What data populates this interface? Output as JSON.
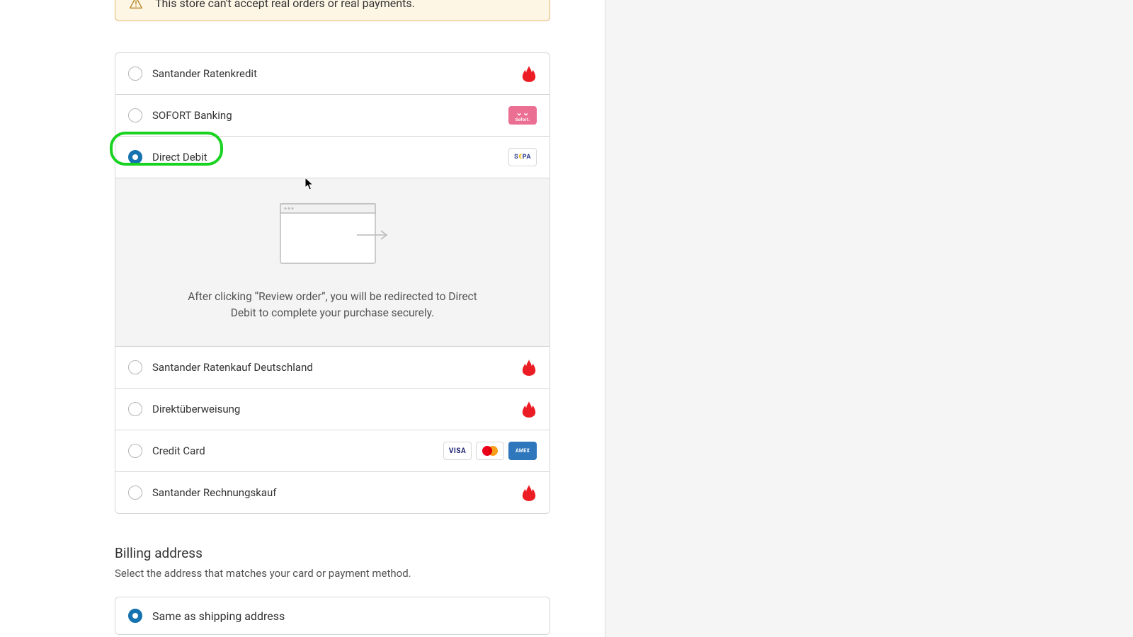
{
  "warning": {
    "text": "This store can't accept real orders or real payments."
  },
  "payment_methods": [
    {
      "id": "santander-ratenkredit",
      "label": "Santander Ratenkredit",
      "selected": false,
      "brand": "santander"
    },
    {
      "id": "sofort",
      "label": "SOFORT Banking",
      "selected": false,
      "brand": "sofort"
    },
    {
      "id": "direct-debit",
      "label": "Direct Debit",
      "selected": true,
      "brand": "sepa"
    },
    {
      "id": "santander-ratenkauf",
      "label": "Santander Ratenkauf Deutschland",
      "selected": false,
      "brand": "santander"
    },
    {
      "id": "direkt-uberweisung",
      "label": "Direktüberweisung",
      "selected": false,
      "brand": "santander"
    },
    {
      "id": "credit-card",
      "label": "Credit Card",
      "selected": false,
      "brand": "cards"
    },
    {
      "id": "santander-rechnung",
      "label": "Santander Rechnungskauf",
      "selected": false,
      "brand": "santander"
    }
  ],
  "detail": {
    "text": "After clicking “Review order”, you will be redirected to Direct Debit to complete your purchase securely."
  },
  "billing": {
    "title": "Billing address",
    "subtitle": "Select the address that matches your card or payment method.",
    "option_same": "Same as shipping address"
  },
  "brands": {
    "sepa_text": "SEPA",
    "visa_text": "VISA",
    "amex_text": "AMEX",
    "sofort_text": "Sofort."
  }
}
